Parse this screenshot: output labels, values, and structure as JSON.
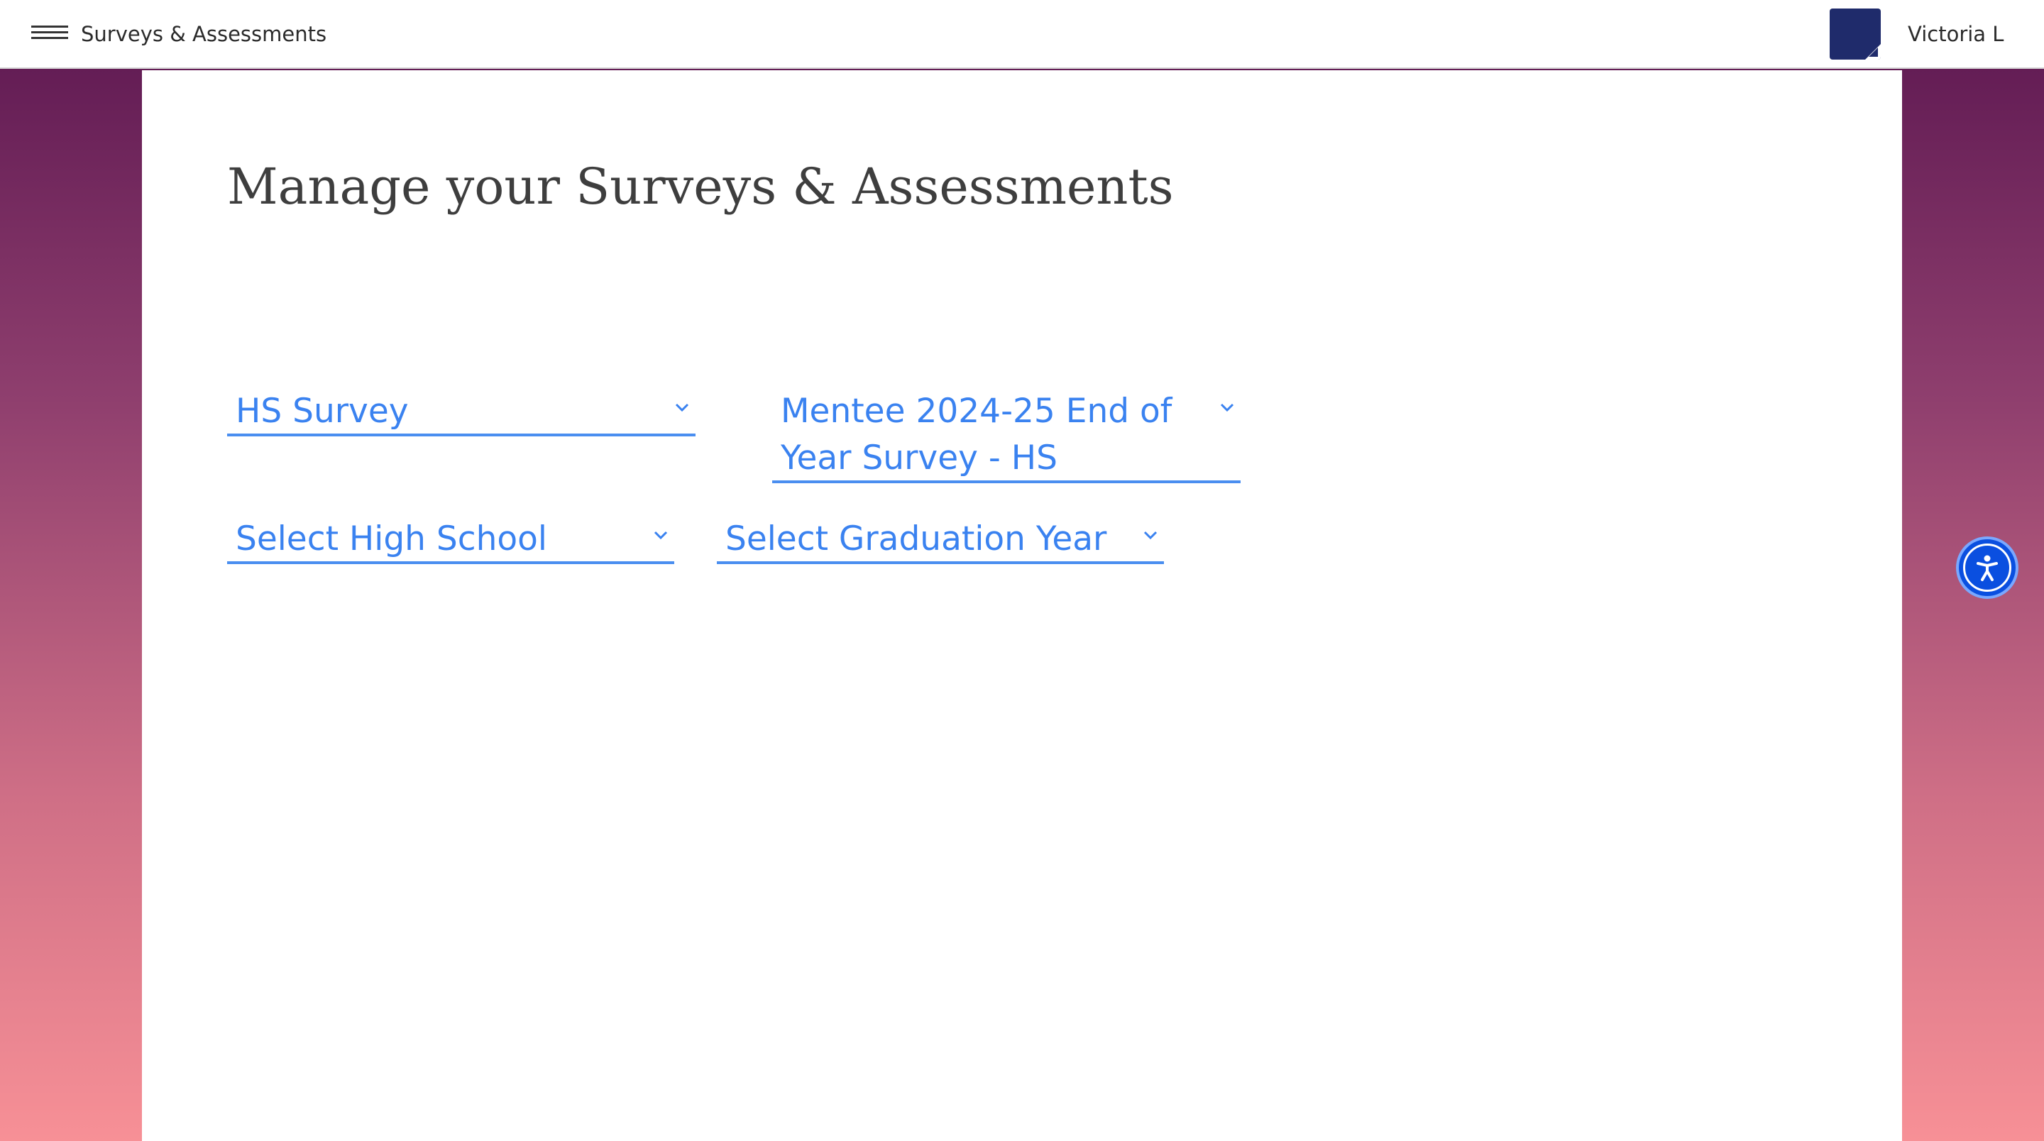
{
  "header": {
    "app_title": "Surveys & Assessments",
    "user_name": "Victoria L"
  },
  "main": {
    "page_title": "Manage your Surveys & Assessments",
    "filters": {
      "survey_type": {
        "value": "HS Survey"
      },
      "survey_name": {
        "value": "Mentee 2024-25 End of Year Survey - HS"
      },
      "high_school": {
        "value": "Select High School"
      },
      "graduation_year": {
        "value": "Select Graduation Year"
      }
    }
  },
  "colors": {
    "select_accent": "#3a82f0",
    "logo_tile": "#1f2b6b",
    "accessibility_button": "#0a4fe0",
    "gradient_top": "#5b1650",
    "gradient_bottom": "#f79096"
  },
  "icons": {
    "menu": "hamburger-icon",
    "dropdown": "chevron-down-icon",
    "accessibility": "accessibility-person-icon"
  }
}
